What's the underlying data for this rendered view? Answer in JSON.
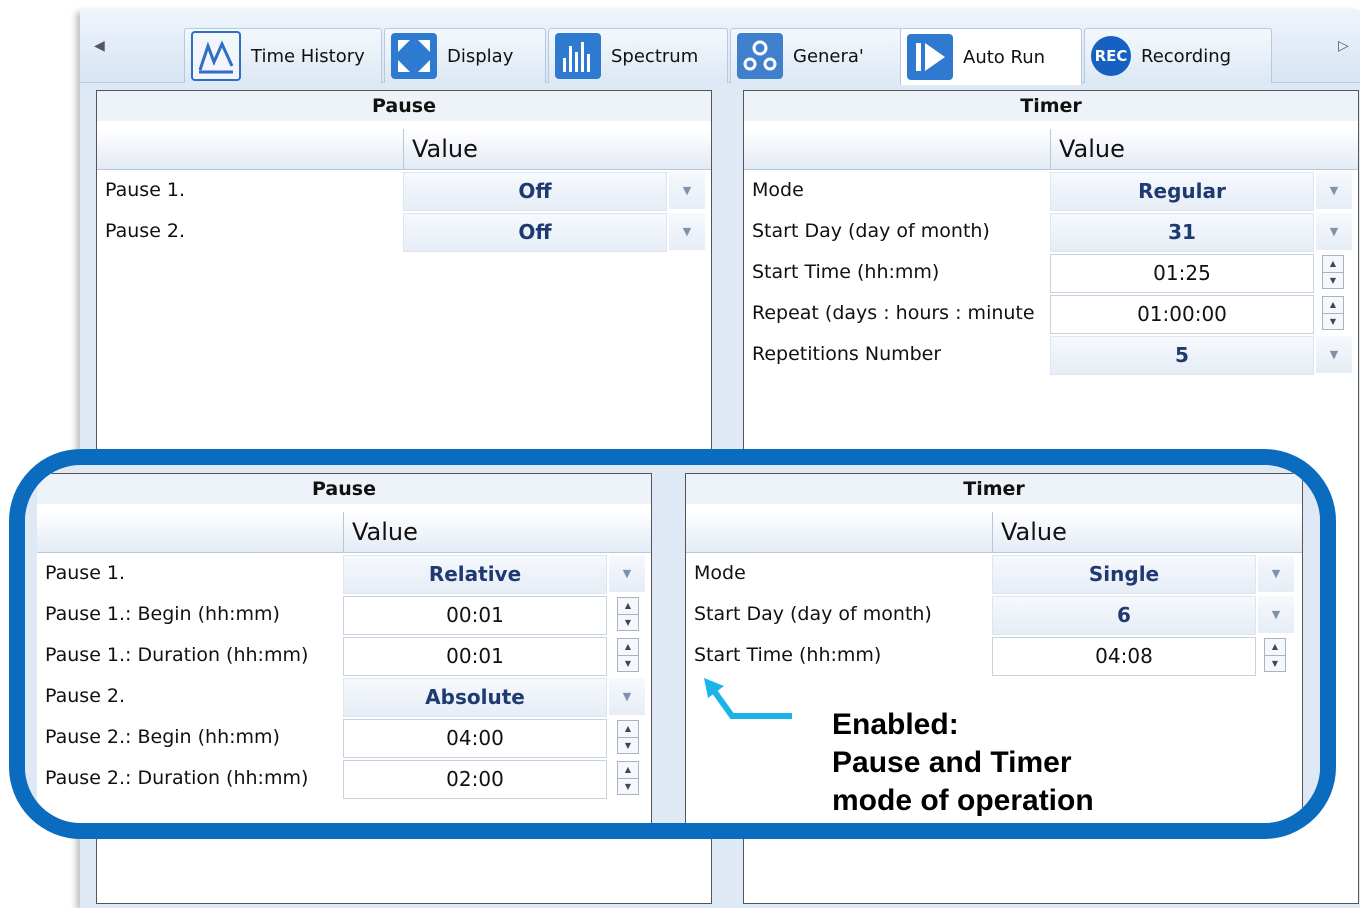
{
  "tabs": [
    {
      "label": "Time History",
      "icon": "time-history-icon"
    },
    {
      "label": "Display",
      "icon": "display-icon"
    },
    {
      "label": "Spectrum",
      "icon": "spectrum-icon"
    },
    {
      "label": "Genera'",
      "icon": "general-icon"
    },
    {
      "label": "Auto Run",
      "icon": "auto-run-icon",
      "active": true
    },
    {
      "label": "Recording",
      "icon": "recording-icon",
      "badge": "REC"
    }
  ],
  "nav": {
    "left": "◀",
    "right": "▷"
  },
  "top": {
    "pause": {
      "title": "Pause",
      "value_header": "Value",
      "rows": [
        {
          "label": "Pause 1.",
          "value": "Off"
        },
        {
          "label": "Pause 2.",
          "value": "Off"
        }
      ]
    },
    "timer": {
      "title": "Timer",
      "value_header": "Value",
      "rows": [
        {
          "label": "Mode",
          "value": "Regular"
        },
        {
          "label": "Start Day (day of month)",
          "value": "31"
        },
        {
          "label": "Start Time (hh:mm)",
          "value": "01:25"
        },
        {
          "label": "Repeat (days : hours : minute",
          "value": "01:00:00"
        },
        {
          "label": "Repetitions Number",
          "value": "5"
        }
      ]
    }
  },
  "overlay": {
    "pause": {
      "title": "Pause",
      "value_header": "Value",
      "rows": [
        {
          "label": "Pause 1.",
          "value": "Relative"
        },
        {
          "label": "Pause 1.: Begin (hh:mm)",
          "value": "00:01"
        },
        {
          "label": "Pause 1.: Duration (hh:mm)",
          "value": "00:01"
        },
        {
          "label": "Pause 2.",
          "value": "Absolute"
        },
        {
          "label": "Pause 2.: Begin (hh:mm)",
          "value": "04:00"
        },
        {
          "label": "Pause 2.: Duration (hh:mm)",
          "value": "02:00"
        }
      ]
    },
    "timer": {
      "title": "Timer",
      "value_header": "Value",
      "rows": [
        {
          "label": "Mode",
          "value": "Single"
        },
        {
          "label": "Start Day (day of month)",
          "value": "6"
        },
        {
          "label": "Start Time (hh:mm)",
          "value": "04:08"
        }
      ]
    },
    "note": [
      "Enabled:",
      "Pause and Timer",
      "mode of operation"
    ]
  },
  "colors": {
    "highlight_border": "#0a6bbf",
    "arrow": "#1ab4e8",
    "value_text": "#1f3a70",
    "rec_badge": "#1560c0"
  }
}
